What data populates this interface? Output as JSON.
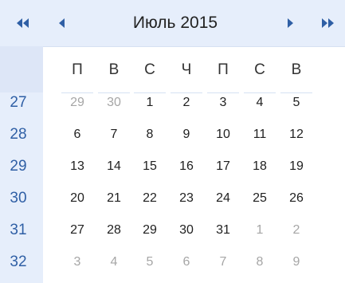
{
  "header": {
    "title": "Июль 2015",
    "prev_year_icon": "double-chevron-left-icon",
    "prev_month_icon": "chevron-left-icon",
    "next_month_icon": "chevron-right-icon",
    "next_year_icon": "double-chevron-right-icon"
  },
  "weekdays": [
    "П",
    "В",
    "С",
    "Ч",
    "П",
    "С",
    "В"
  ],
  "weeks": [
    {
      "number": "27",
      "days": [
        {
          "label": "29",
          "other": true
        },
        {
          "label": "30",
          "other": true
        },
        {
          "label": "1",
          "other": false
        },
        {
          "label": "2",
          "other": false
        },
        {
          "label": "3",
          "other": false
        },
        {
          "label": "4",
          "other": false
        },
        {
          "label": "5",
          "other": false
        }
      ]
    },
    {
      "number": "28",
      "days": [
        {
          "label": "6",
          "other": false
        },
        {
          "label": "7",
          "other": false
        },
        {
          "label": "8",
          "other": false
        },
        {
          "label": "9",
          "other": false
        },
        {
          "label": "10",
          "other": false
        },
        {
          "label": "11",
          "other": false
        },
        {
          "label": "12",
          "other": false
        }
      ]
    },
    {
      "number": "29",
      "days": [
        {
          "label": "13",
          "other": false
        },
        {
          "label": "14",
          "other": false
        },
        {
          "label": "15",
          "other": false
        },
        {
          "label": "16",
          "other": false
        },
        {
          "label": "17",
          "other": false
        },
        {
          "label": "18",
          "other": false
        },
        {
          "label": "19",
          "other": false
        }
      ]
    },
    {
      "number": "30",
      "days": [
        {
          "label": "20",
          "other": false
        },
        {
          "label": "21",
          "other": false
        },
        {
          "label": "22",
          "other": false
        },
        {
          "label": "23",
          "other": false
        },
        {
          "label": "24",
          "other": false
        },
        {
          "label": "25",
          "other": false
        },
        {
          "label": "26",
          "other": false
        }
      ]
    },
    {
      "number": "31",
      "days": [
        {
          "label": "27",
          "other": false
        },
        {
          "label": "28",
          "other": false
        },
        {
          "label": "29",
          "other": false
        },
        {
          "label": "30",
          "other": false
        },
        {
          "label": "31",
          "other": false
        },
        {
          "label": "1",
          "other": true
        },
        {
          "label": "2",
          "other": true
        }
      ]
    },
    {
      "number": "32",
      "days": [
        {
          "label": "3",
          "other": true
        },
        {
          "label": "4",
          "other": true
        },
        {
          "label": "5",
          "other": true
        },
        {
          "label": "6",
          "other": true
        },
        {
          "label": "7",
          "other": true
        },
        {
          "label": "8",
          "other": true
        },
        {
          "label": "9",
          "other": true
        }
      ]
    }
  ],
  "colors": {
    "header_bg": "#e6eefb",
    "week_number": "#2f5fa5",
    "day_text": "#1f1f1f",
    "other_month_text": "#a6a6a6",
    "nav_arrow": "#2f5fa5"
  }
}
